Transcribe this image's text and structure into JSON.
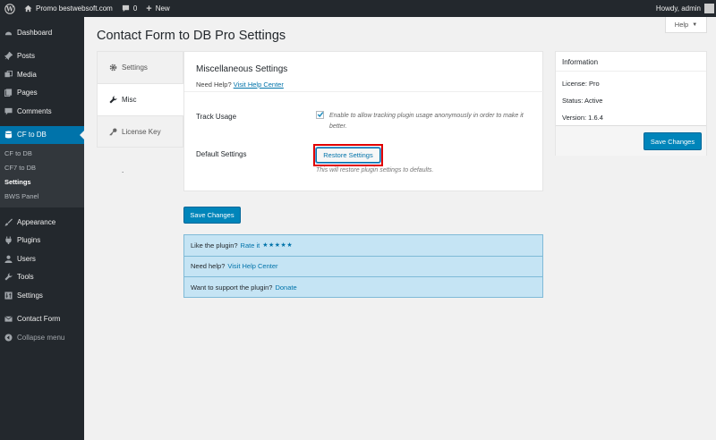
{
  "adminbar": {
    "site_name": "Promo bestwebsoft.com",
    "comments_count": "0",
    "new_label": "New",
    "howdy": "Howdy, admin"
  },
  "sidebar": {
    "items": [
      {
        "label": "Dashboard",
        "icon": "dashboard-icon"
      },
      {
        "label": "Posts",
        "icon": "pin-icon"
      },
      {
        "label": "Media",
        "icon": "media-icon"
      },
      {
        "label": "Pages",
        "icon": "page-icon"
      },
      {
        "label": "Comments",
        "icon": "comment-icon"
      },
      {
        "label": "CF to DB",
        "icon": "database-icon"
      },
      {
        "label": "Appearance",
        "icon": "brush-icon"
      },
      {
        "label": "Plugins",
        "icon": "plug-icon"
      },
      {
        "label": "Users",
        "icon": "user-icon"
      },
      {
        "label": "Tools",
        "icon": "wrench-icon"
      },
      {
        "label": "Settings",
        "icon": "settings-icon"
      },
      {
        "label": "Contact Form",
        "icon": "mail-icon"
      },
      {
        "label": "Collapse menu",
        "icon": "collapse-icon"
      }
    ],
    "submenu": [
      "CF to DB",
      "CF7 to DB",
      "Settings",
      "BWS Panel"
    ]
  },
  "help_label": "Help",
  "page_title": "Contact Form to DB Pro Settings",
  "tabs": [
    {
      "label": "Settings",
      "icon": "gear-icon"
    },
    {
      "label": "Misc",
      "icon": "wrench-icon"
    },
    {
      "label": "License Key",
      "icon": "key-icon"
    }
  ],
  "tabs_dot": ".",
  "panel": {
    "heading": "Miscellaneous Settings",
    "need_help_prefix": "Need Help?",
    "need_help_link": "Visit Help Center",
    "track_usage_label": "Track Usage",
    "track_usage_checked": true,
    "track_usage_desc": "Enable to allow tracking plugin usage anonymously in order to make it better.",
    "default_settings_label": "Default Settings",
    "restore_button": "Restore Settings",
    "restore_desc": "This will restore plugin settings to defaults."
  },
  "save_changes": "Save Changes",
  "promo": {
    "rate_prefix": "Like the plugin?",
    "rate_link": "Rate it",
    "stars": "★★★★★",
    "help_prefix": "Need help?",
    "help_link": "Visit Help Center",
    "donate_prefix": "Want to support the plugin?",
    "donate_link": "Donate"
  },
  "info": {
    "title": "Information",
    "license": "License: Pro",
    "status": "Status: Active",
    "version": "Version: 1.6.4",
    "save_button": "Save Changes"
  },
  "colors": {
    "accent": "#0073aa",
    "primary_button": "#0085ba",
    "sidebar_bg": "#23282d",
    "promo_bg": "#c5e4f4",
    "highlight": "#e00000"
  }
}
